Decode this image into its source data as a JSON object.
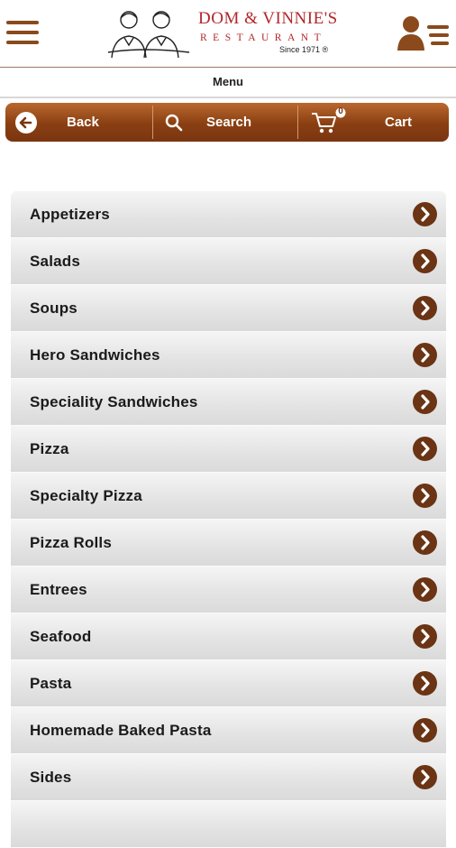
{
  "header": {
    "logo_line1": "DOM & VINNIE'S",
    "logo_line2": "RESTAURANT",
    "logo_since": "Since 1971 ®"
  },
  "subheader": {
    "title": "Menu"
  },
  "nav": {
    "back_label": "Back",
    "search_label": "Search",
    "cart_label": "Cart",
    "cart_count": "0"
  },
  "menu": {
    "items": [
      {
        "label": "Appetizers"
      },
      {
        "label": "Salads"
      },
      {
        "label": "Soups"
      },
      {
        "label": "Hero Sandwiches"
      },
      {
        "label": "Speciality Sandwiches"
      },
      {
        "label": "Pizza"
      },
      {
        "label": "Specialty Pizza"
      },
      {
        "label": "Pizza Rolls"
      },
      {
        "label": "Entrees"
      },
      {
        "label": "Seafood"
      },
      {
        "label": "Pasta"
      },
      {
        "label": "Homemade Baked Pasta"
      },
      {
        "label": "Sides"
      },
      {
        "label": ""
      }
    ]
  },
  "colors": {
    "brand": "#8a3f12",
    "logo_red": "#b2262a",
    "chevron": "#6b3414"
  },
  "icons": [
    "hamburger-menu-icon",
    "account-list-icon",
    "back-arrow-icon",
    "search-icon",
    "cart-icon",
    "chevron-right-icon"
  ]
}
